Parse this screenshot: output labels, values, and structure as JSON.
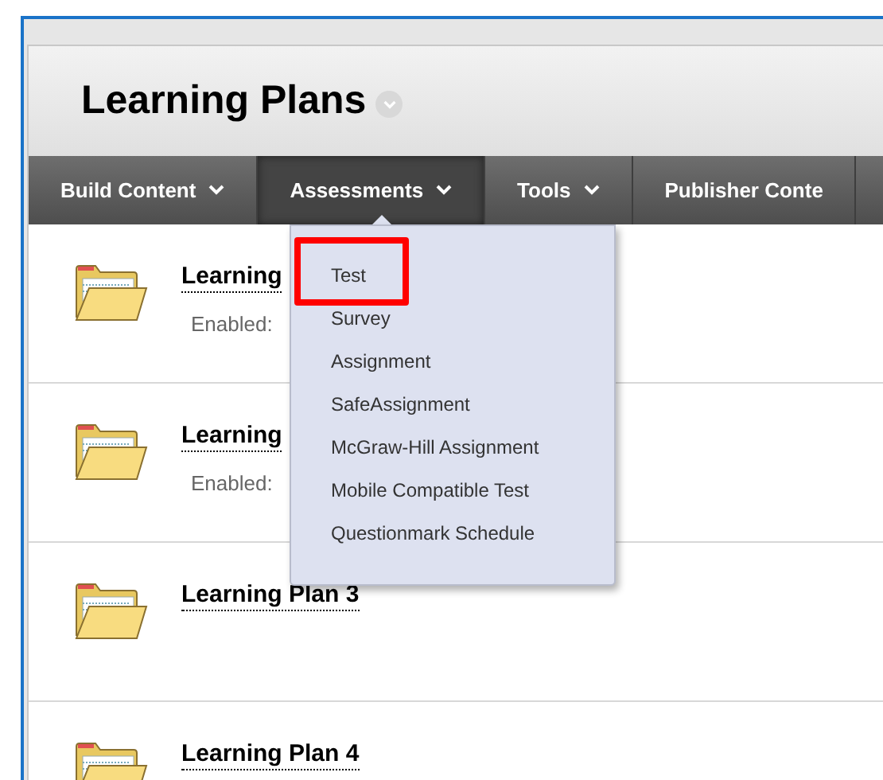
{
  "page": {
    "title": "Learning Plans"
  },
  "nav": [
    {
      "label": "Build Content",
      "selected": false,
      "has_caret": true
    },
    {
      "label": "Assessments",
      "selected": true,
      "has_caret": true
    },
    {
      "label": "Tools",
      "selected": false,
      "has_caret": true
    },
    {
      "label": "Publisher Conte",
      "selected": false,
      "has_caret": false
    }
  ],
  "menu": [
    {
      "label": "Test",
      "highlighted": true
    },
    {
      "label": "Survey",
      "highlighted": false
    },
    {
      "label": "Assignment",
      "highlighted": false
    },
    {
      "label": "SafeAssignment",
      "highlighted": false
    },
    {
      "label": "McGraw-Hill Assignment",
      "highlighted": false
    },
    {
      "label": "Mobile Compatible Test",
      "highlighted": false
    },
    {
      "label": "Questionmark Schedule",
      "highlighted": false
    }
  ],
  "items": [
    {
      "title": "Learning",
      "detail": "Enabled:"
    },
    {
      "title": "Learning",
      "detail": "Enabled:"
    },
    {
      "title": "Learning Plan 3"
    },
    {
      "title": "Learning Plan 4"
    }
  ]
}
